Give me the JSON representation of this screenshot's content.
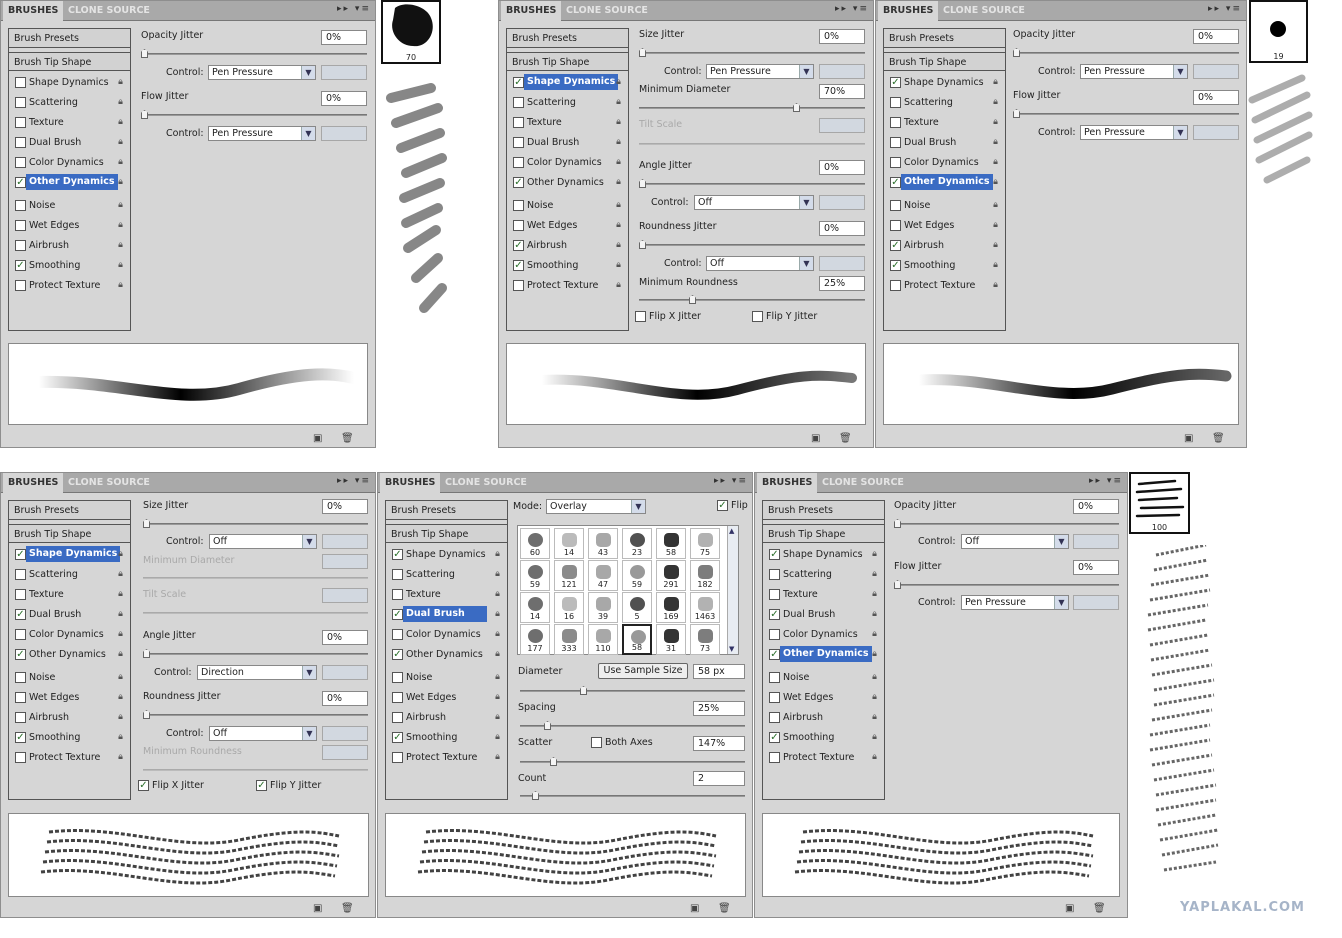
{
  "tabs": {
    "brushes": "BRUSHES",
    "clone": "CLONE SOURCE"
  },
  "icons": {
    "menu": "panel-menu-icon",
    "lock": "lock-icon",
    "new": "new-brush-icon",
    "trash": "trash-icon"
  },
  "labels": {
    "brush_presets": "Brush Presets",
    "brush_tip_shape": "Brush Tip Shape",
    "shape_dynamics": "Shape Dynamics",
    "scattering": "Scattering",
    "texture": "Texture",
    "dual_brush": "Dual Brush",
    "color_dynamics": "Color Dynamics",
    "other_dynamics": "Other Dynamics",
    "noise": "Noise",
    "wet_edges": "Wet Edges",
    "airbrush": "Airbrush",
    "smoothing": "Smoothing",
    "protect_texture": "Protect Texture",
    "opacity_jitter": "Opacity Jitter",
    "flow_jitter": "Flow Jitter",
    "control": "Control:",
    "size_jitter": "Size Jitter",
    "min_diameter": "Minimum Diameter",
    "tilt_scale": "Tilt Scale",
    "angle_jitter": "Angle Jitter",
    "roundness_jitter": "Roundness Jitter",
    "min_roundness": "Minimum Roundness",
    "flip_x": "Flip X Jitter",
    "flip_y": "Flip Y Jitter",
    "mode": "Mode:",
    "flip": "Flip",
    "diameter": "Diameter",
    "use_sample": "Use Sample Size",
    "spacing": "Spacing",
    "scatter": "Scatter",
    "both_axes": "Both Axes",
    "count": "Count"
  },
  "values": {
    "zero": "0%",
    "seventy": "70%",
    "twentyfive": "25%",
    "diam_px": "58 px",
    "spacing": "25%",
    "scatter": "147%",
    "count": "2",
    "pen_pressure": "Pen Pressure",
    "off": "Off",
    "direction": "Direction",
    "overlay": "Overlay"
  },
  "thumbs": {
    "t1": "70",
    "t2": "19",
    "t3": "100"
  },
  "brush_grid": [
    "60",
    "14",
    "43",
    "23",
    "58",
    "75",
    "59",
    "121",
    "47",
    "59",
    "291",
    "182",
    "14",
    "16",
    "39",
    "5",
    "169",
    "1463",
    "177",
    "333",
    "110",
    "58",
    "31",
    "73"
  ],
  "watermark": "YAPLAKAL.COM"
}
